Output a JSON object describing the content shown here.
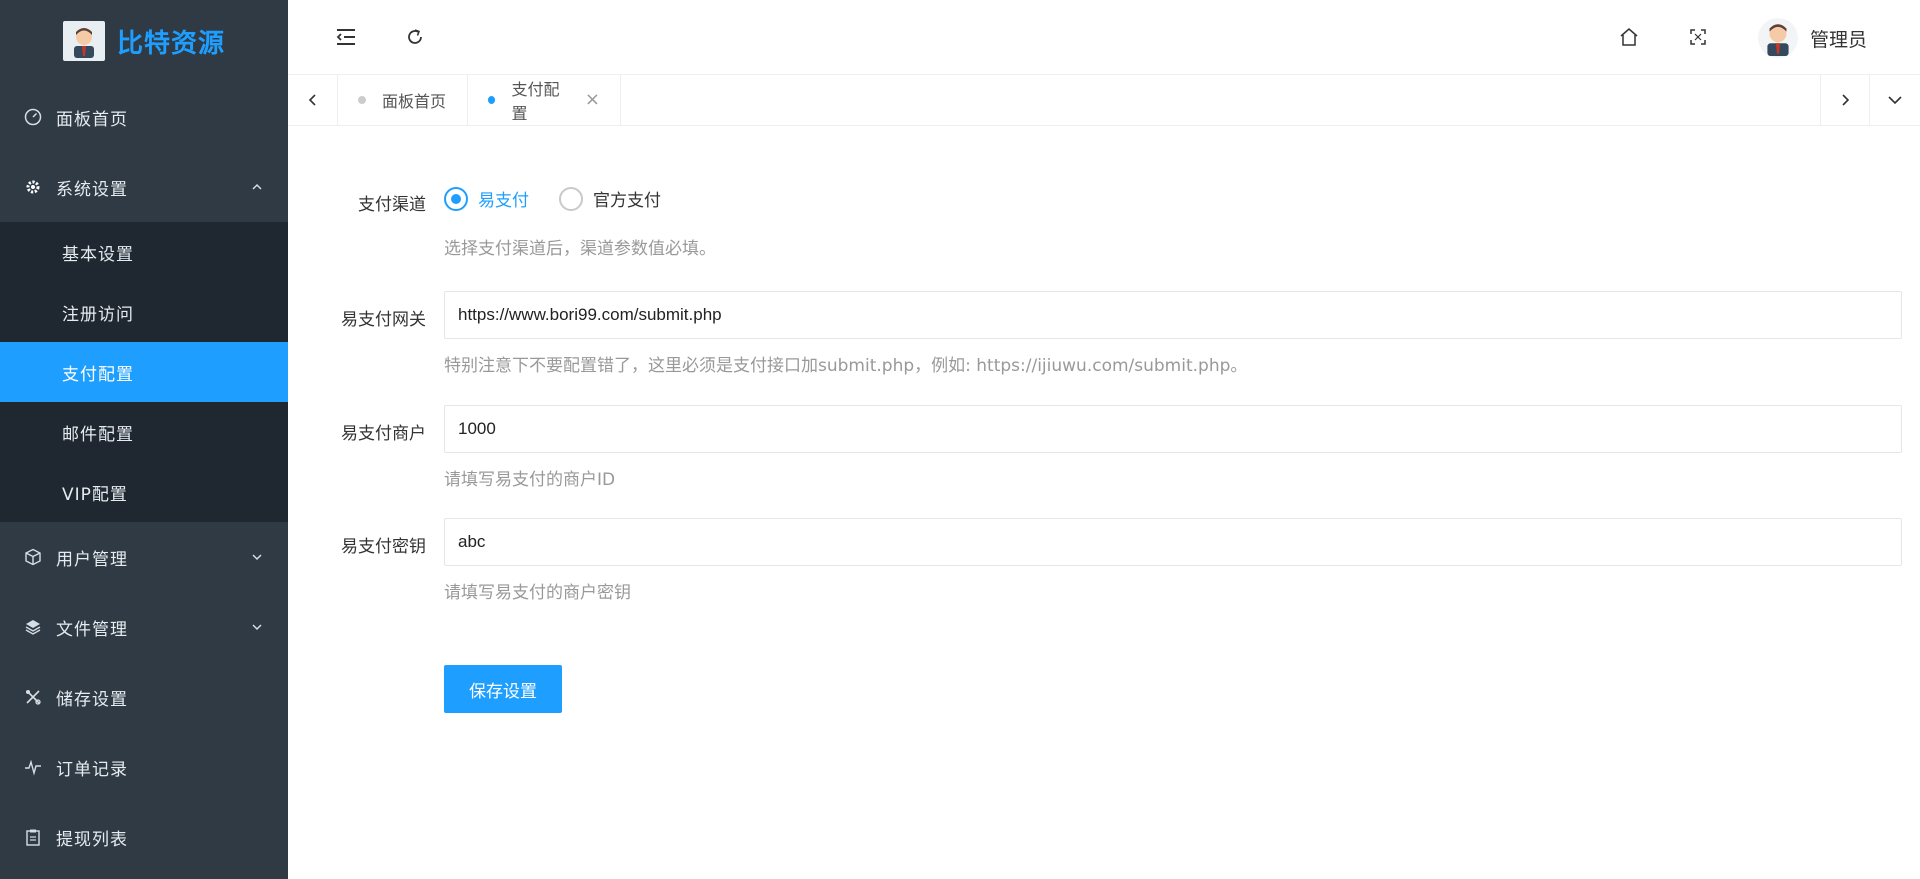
{
  "brand": {
    "name": "比特资源"
  },
  "sidebar": {
    "items": [
      {
        "label": "面板首页",
        "icon": "gauge-icon"
      },
      {
        "label": "系统设置",
        "icon": "gear-icon",
        "expanded": true,
        "children": [
          {
            "label": "基本设置"
          },
          {
            "label": "注册访问"
          },
          {
            "label": "支付配置",
            "active": true
          },
          {
            "label": "邮件配置"
          },
          {
            "label": "VIP配置"
          }
        ]
      },
      {
        "label": "用户管理",
        "icon": "cube-icon"
      },
      {
        "label": "文件管理",
        "icon": "layers-icon"
      },
      {
        "label": "储存设置",
        "icon": "tools-icon"
      },
      {
        "label": "订单记录",
        "icon": "pulse-icon"
      },
      {
        "label": "提现列表",
        "icon": "clipboard-icon"
      }
    ]
  },
  "header": {
    "user_name": "管理员"
  },
  "tabs": [
    {
      "label": "面板首页",
      "active": false
    },
    {
      "label": "支付配置",
      "active": true,
      "close": "×"
    }
  ],
  "form": {
    "channel": {
      "label": "支付渠道",
      "options": [
        {
          "label": "易支付",
          "checked": true
        },
        {
          "label": "官方支付",
          "checked": false
        }
      ],
      "help": "选择支付渠道后，渠道参数值必填。"
    },
    "gateway": {
      "label": "易支付网关",
      "value": "https://www.bori99.com/submit.php",
      "help": "特别注意下不要配置错了，这里必须是支付接口加submit.php，例如: https://ijiuwu.com/submit.php。"
    },
    "merchant": {
      "label": "易支付商户",
      "value": "1000",
      "help": "请填写易支付的商户ID"
    },
    "secret": {
      "label": "易支付密钥",
      "value": "abc",
      "help": "请填写易支付的商户密钥"
    },
    "save_label": "保存设置"
  },
  "colors": {
    "sidebar_bg": "#2f3a45",
    "submenu_bg": "#1f2830",
    "accent": "#1e9fff"
  }
}
